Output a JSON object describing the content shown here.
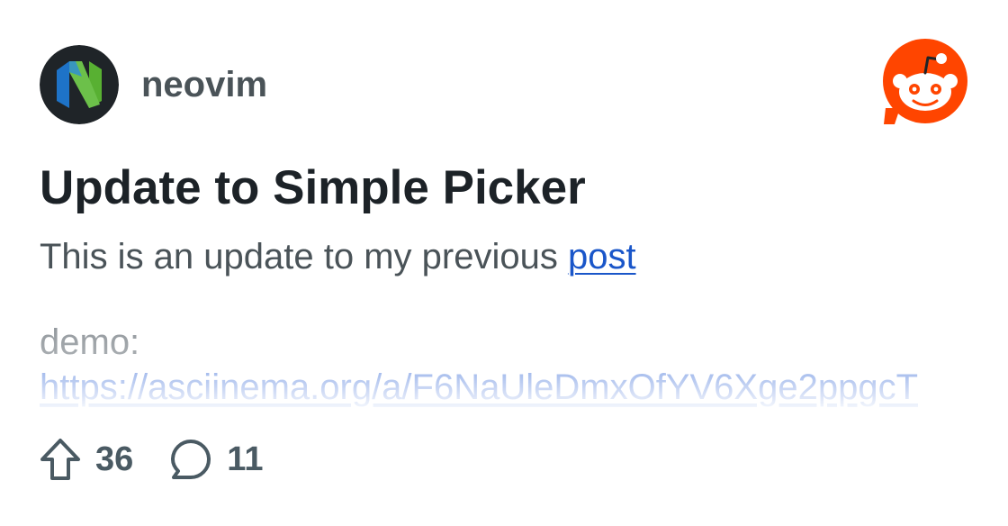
{
  "community": {
    "name": "neovim",
    "avatar_icon": "neovim-logo-icon"
  },
  "brand_icon": "reddit-logo-icon",
  "post": {
    "title": "Update to Simple Picker",
    "body_prefix": "This is an update to my previous ",
    "body_link": "post",
    "demo_label": "demo:",
    "demo_url": "https://asciinema.org/a/F6NaUleDmxOfYV6Xge2ppgcT"
  },
  "stats": {
    "upvotes": "36",
    "upvote_icon": "upvote-arrow-icon",
    "comments": "11",
    "comment_icon": "comment-bubble-icon"
  },
  "colors": {
    "title": "#1c2227",
    "body": "#4a5358",
    "link": "#1a56c9",
    "reddit_orange": "#ff4500"
  }
}
